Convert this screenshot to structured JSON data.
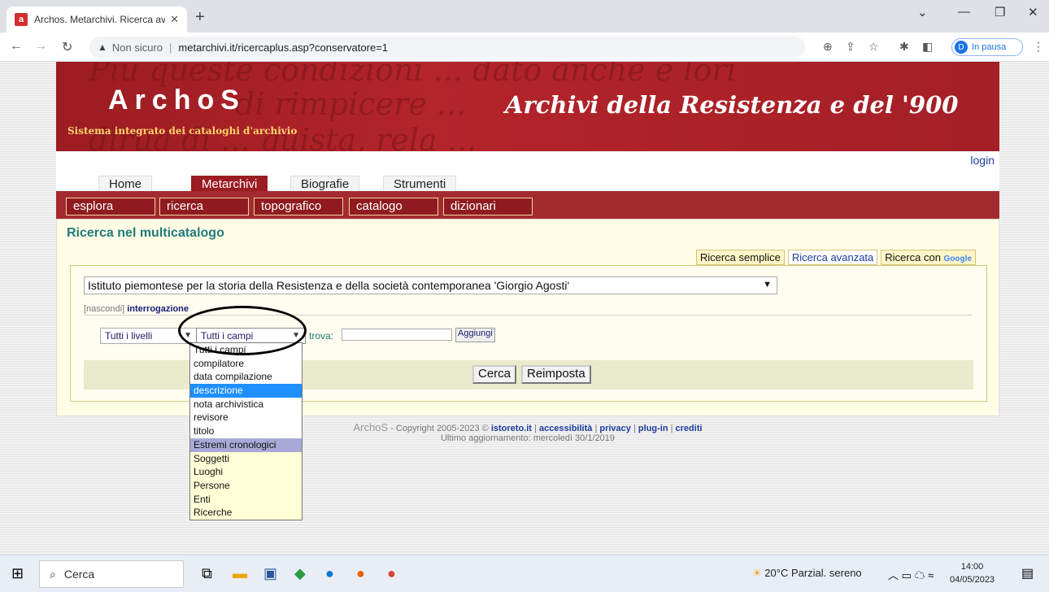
{
  "browser": {
    "tab_title": "Archos. Metarchivi. Ricerca avanz",
    "tab_icon": "a",
    "security_label": "Non sicuro",
    "url": "metarchivi.it/ricercaplus.asp?conservatore=1",
    "profile_initial": "D",
    "profile_status": "In pausa"
  },
  "banner": {
    "logo": "ArchoS",
    "logo_subtitle": "Sistema integrato dei cataloghi d'archivio",
    "headline": "Archivi della Resistenza e del '900"
  },
  "login": "login",
  "top_nav": [
    "Home",
    "Metarchivi",
    "Biografie",
    "Strumenti"
  ],
  "sub_nav": [
    "esplora",
    "ricerca",
    "topografico",
    "catalogo",
    "dizionari"
  ],
  "page_title": "Ricerca nel multicatalogo",
  "search_modes": {
    "simple": "Ricerca semplice",
    "advanced": "Ricerca avanzata",
    "google_prefix": "Ricerca con",
    "google_word": "Google"
  },
  "institute_selected": "Istituto piemontese per la storia della Resistenza e della società contemporanea 'Giorgio Agosti'",
  "query_toggle": {
    "hide": "[nascondi]",
    "label": "interrogazione"
  },
  "query_row": {
    "level": "Tutti i livelli",
    "field": "Tutti i campi",
    "find_label": "trova:",
    "find_value": "",
    "add_button": "Aggiungi"
  },
  "buttons": {
    "search": "Cerca",
    "reset": "Reimposta"
  },
  "field_options": [
    "Tutti i campi",
    "compilatore",
    "data compilazione",
    "descrizione",
    "nota archivistica",
    "revisore",
    "titolo",
    "Estremi cronologici",
    "Soggetti",
    "Luoghi",
    "Persone",
    "Enti",
    "Ricerche"
  ],
  "footer": {
    "brand": "ArchoS",
    "copyright": "- Copyright 2005-2023 ©",
    "links": [
      "istoreto.it",
      "accessibilità",
      "privacy",
      "plug-in",
      "crediti"
    ],
    "updated": "Ultimo aggiornamento: mercoledì 30/1/2019"
  },
  "taskbar": {
    "search_placeholder": "Cerca",
    "weather": "20°C  Parzial. sereno",
    "time": "14:00",
    "date": "04/05/2023"
  }
}
